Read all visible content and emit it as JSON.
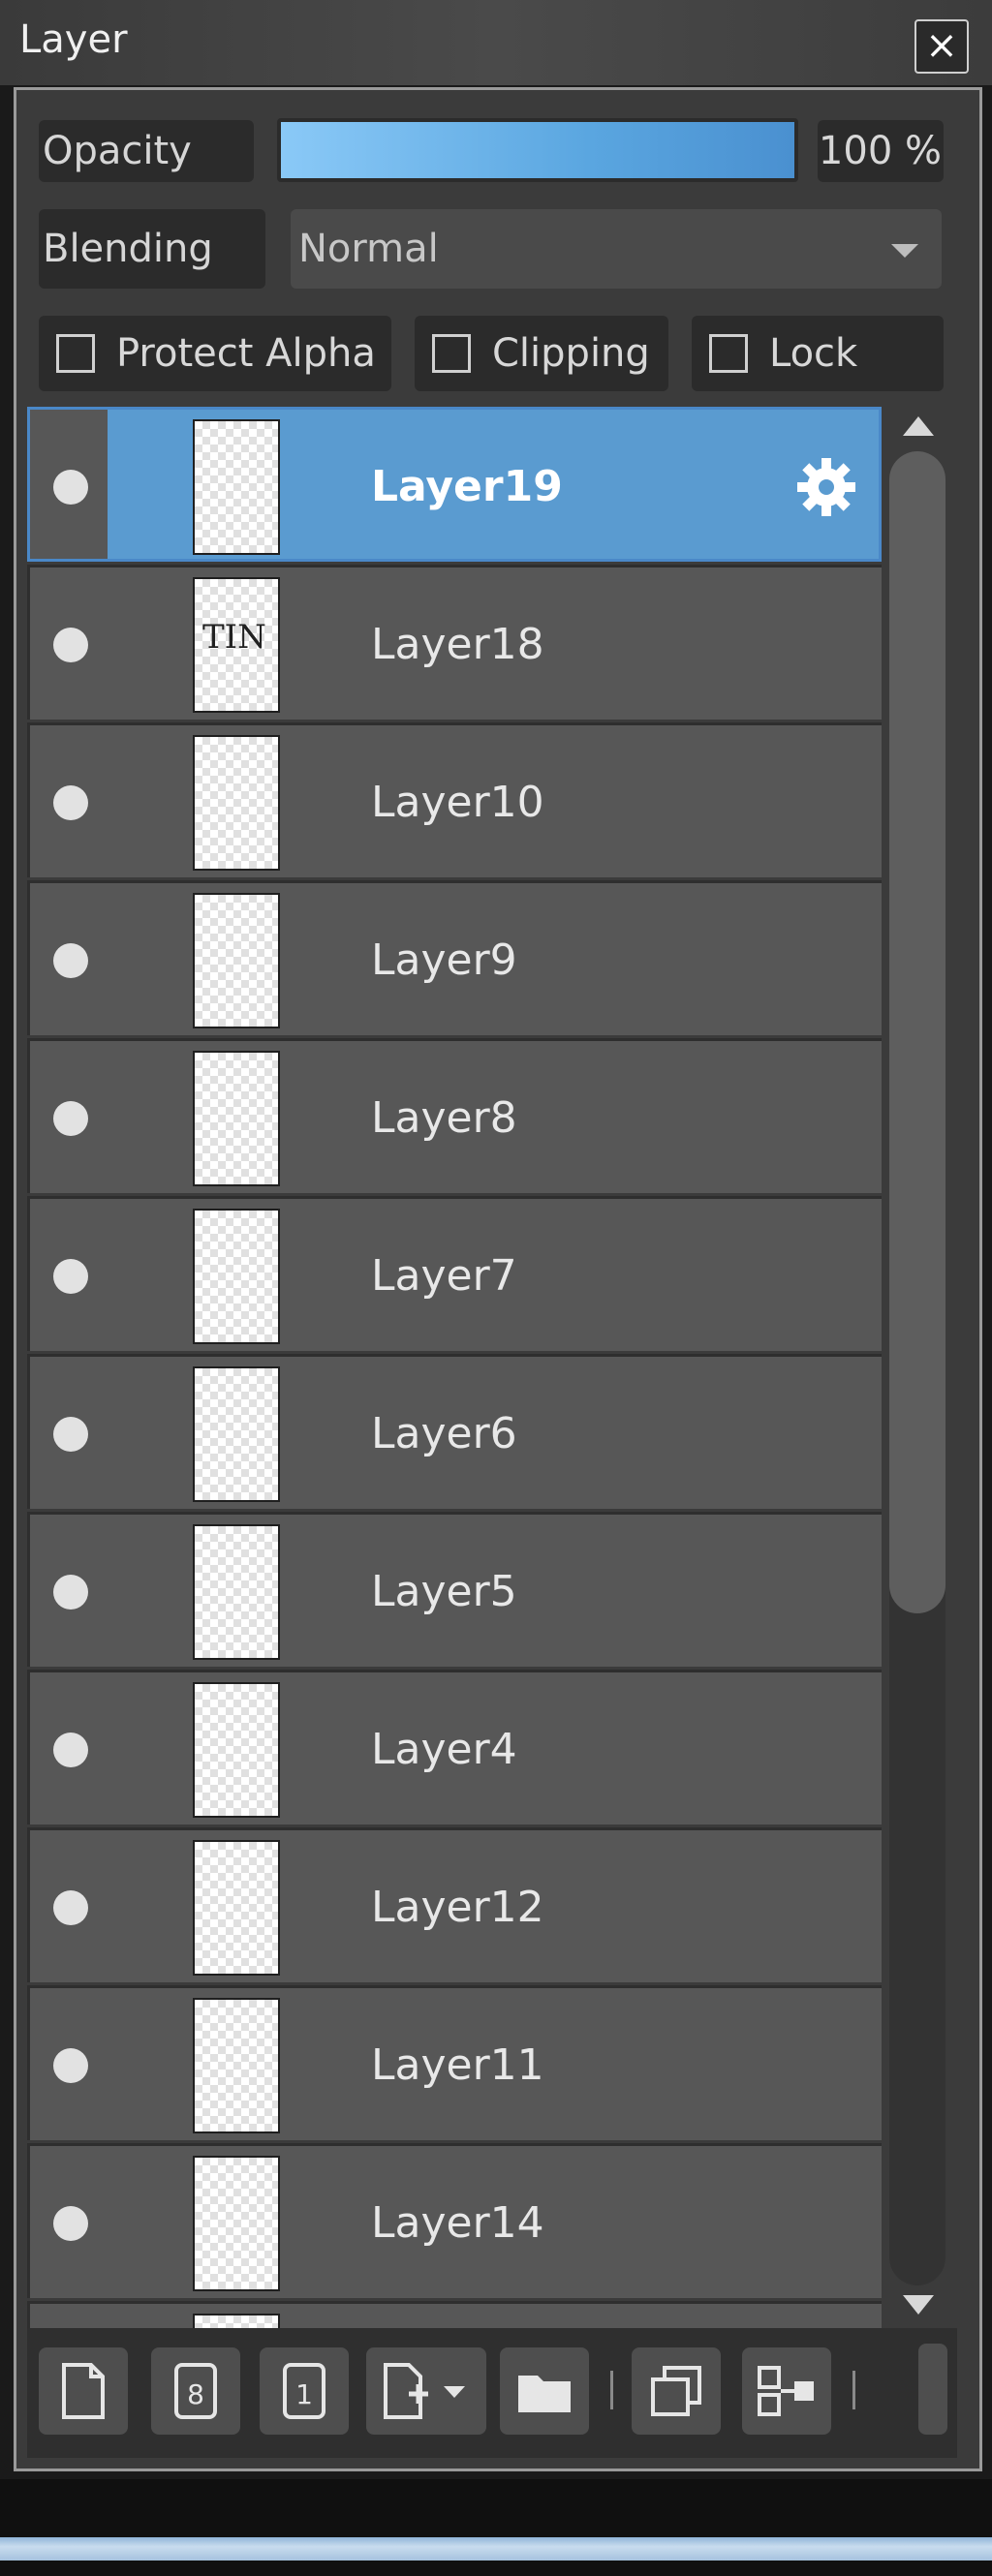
{
  "window": {
    "title": "Layer",
    "close_glyph": "×"
  },
  "controls": {
    "opacity_label": "Opacity",
    "opacity_value": "100 %",
    "opacity_fraction": 1.0,
    "blending_label": "Blending",
    "blending_value": "Normal"
  },
  "checkboxes": [
    {
      "label": "Protect Alpha",
      "checked": false
    },
    {
      "label": "Clipping",
      "checked": false
    },
    {
      "label": "Lock",
      "checked": false
    }
  ],
  "layers": [
    {
      "name": "Layer19",
      "selected": true,
      "visible": true,
      "thumb_mark": ""
    },
    {
      "name": "Layer18",
      "selected": false,
      "visible": true,
      "thumb_mark": "TIN"
    },
    {
      "name": "Layer10",
      "selected": false,
      "visible": true,
      "thumb_mark": ""
    },
    {
      "name": "Layer9",
      "selected": false,
      "visible": true,
      "thumb_mark": ""
    },
    {
      "name": "Layer8",
      "selected": false,
      "visible": true,
      "thumb_mark": ""
    },
    {
      "name": "Layer7",
      "selected": false,
      "visible": true,
      "thumb_mark": ""
    },
    {
      "name": "Layer6",
      "selected": false,
      "visible": true,
      "thumb_mark": ""
    },
    {
      "name": "Layer5",
      "selected": false,
      "visible": true,
      "thumb_mark": ""
    },
    {
      "name": "Layer4",
      "selected": false,
      "visible": true,
      "thumb_mark": ""
    },
    {
      "name": "Layer12",
      "selected": false,
      "visible": true,
      "thumb_mark": ""
    },
    {
      "name": "Layer11",
      "selected": false,
      "visible": true,
      "thumb_mark": ""
    },
    {
      "name": "Layer14",
      "selected": false,
      "visible": true,
      "thumb_mark": ""
    },
    {
      "name": "",
      "selected": false,
      "visible": true,
      "thumb_mark": ""
    }
  ],
  "toolbar": {
    "icons": [
      "new-layer-icon",
      "new-8bit-layer-icon",
      "new-1bit-layer-icon",
      "add-layer-menu-icon",
      "new-folder-icon",
      "duplicate-layer-icon",
      "merge-down-icon"
    ]
  },
  "colors": {
    "accent": "#5a9bd0",
    "panel": "#3b3b3b",
    "row": "#575757"
  }
}
